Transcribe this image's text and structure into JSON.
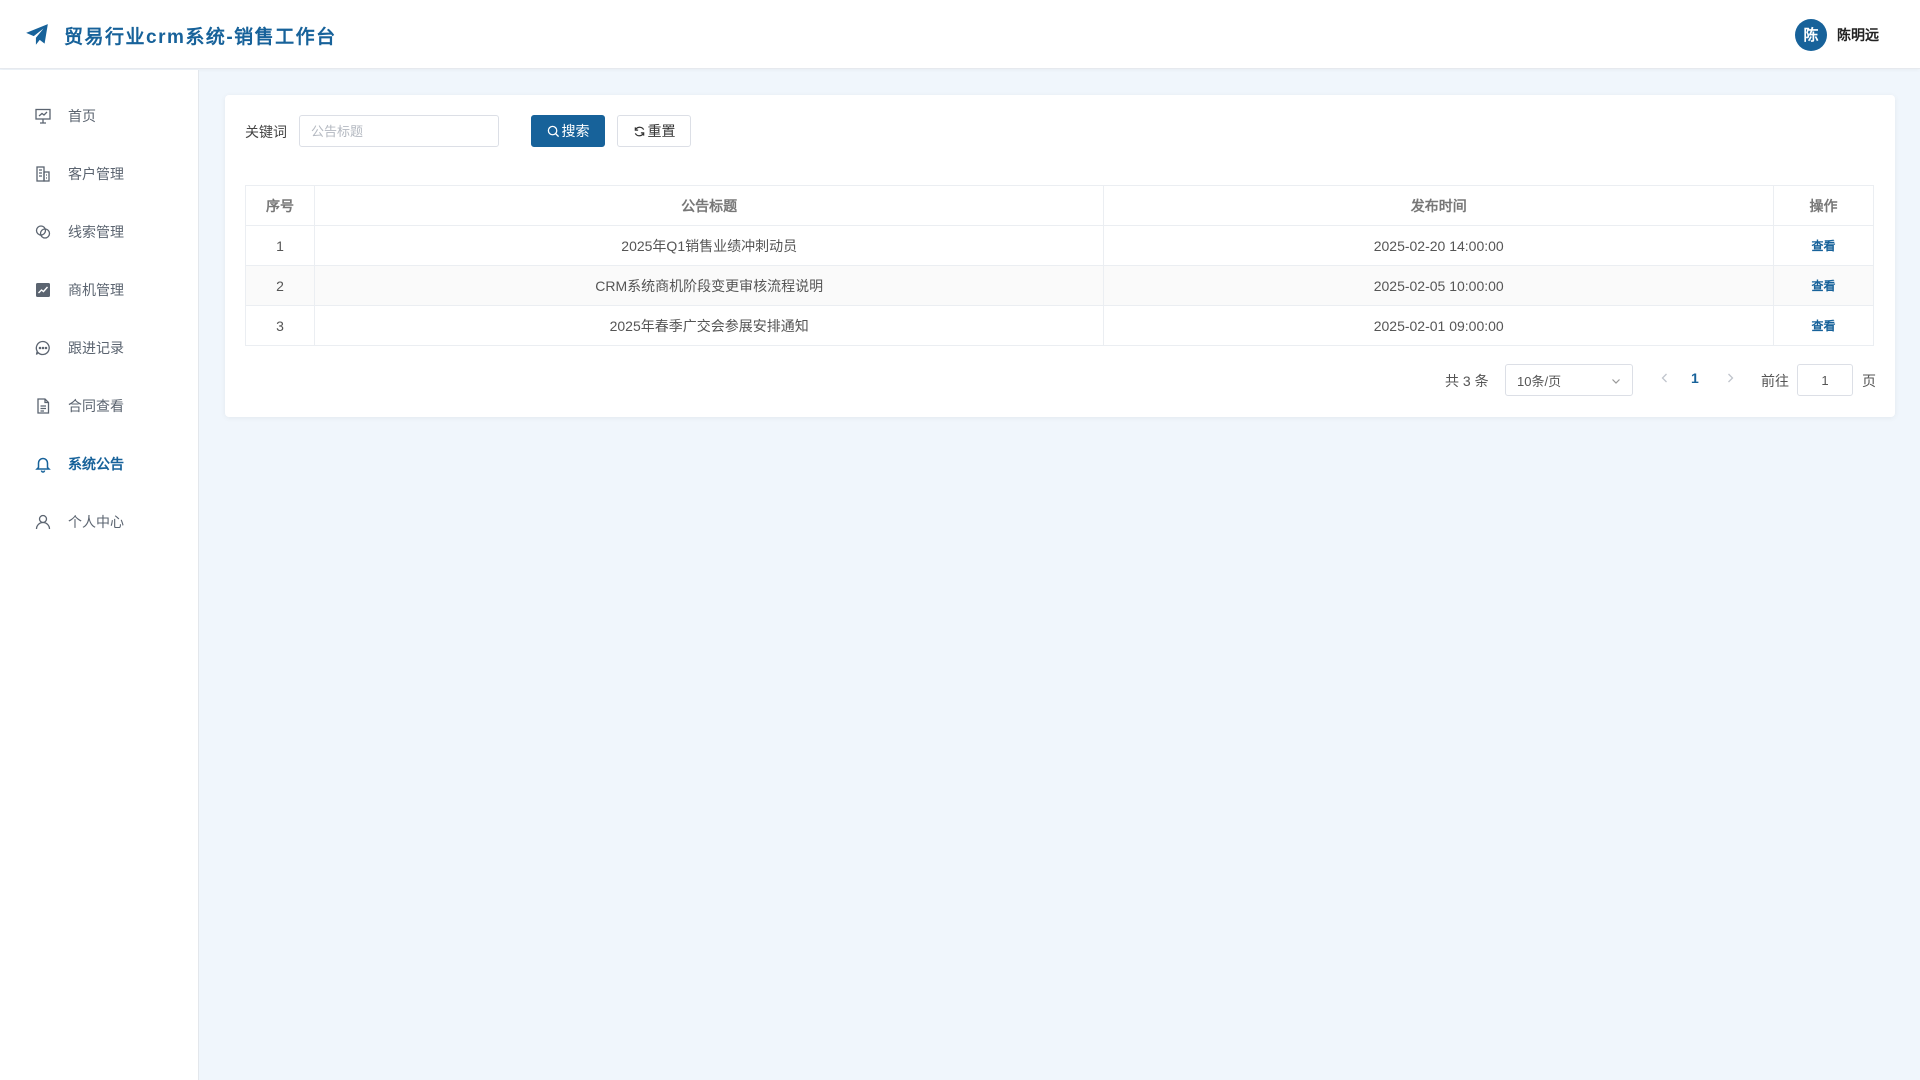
{
  "header": {
    "title": "贸易行业crm系统-销售工作台",
    "brand_icon": "paper-plane-icon",
    "user": {
      "avatar_text": "陈",
      "name": "陈明远"
    }
  },
  "sidebar": {
    "active_index": 6,
    "items": [
      {
        "label": "首页",
        "icon": "dashboard-icon"
      },
      {
        "label": "客户管理",
        "icon": "building-icon"
      },
      {
        "label": "线索管理",
        "icon": "link-icon"
      },
      {
        "label": "商机管理",
        "icon": "chart-icon"
      },
      {
        "label": "跟进记录",
        "icon": "chat-icon"
      },
      {
        "label": "合同查看",
        "icon": "document-icon"
      },
      {
        "label": "系统公告",
        "icon": "bell-icon"
      },
      {
        "label": "个人中心",
        "icon": "user-icon"
      }
    ]
  },
  "search": {
    "keyword_label": "关键词",
    "placeholder": "公告标题",
    "value": "",
    "search_label": "搜索",
    "reset_label": "重置"
  },
  "table": {
    "headers": [
      "序号",
      "公告标题",
      "发布时间",
      "操作"
    ],
    "rows": [
      {
        "index": "1",
        "title": "2025年Q1销售业绩冲刺动员",
        "time": "2025-02-20 14:00:00",
        "action": "查看"
      },
      {
        "index": "2",
        "title": "CRM系统商机阶段变更审核流程说明",
        "time": "2025-02-05 10:00:00",
        "action": "查看"
      },
      {
        "index": "3",
        "title": "2025年春季广交会参展安排通知",
        "time": "2025-02-01 09:00:00",
        "action": "查看"
      }
    ]
  },
  "pagination": {
    "total_text": "共 3 条",
    "page_size": "10条/页",
    "current_page": "1",
    "goto_label": "前往",
    "goto_value": "1",
    "page_suffix": "页"
  },
  "colors": {
    "accent": "#17629a",
    "background": "#f0f6fc"
  }
}
